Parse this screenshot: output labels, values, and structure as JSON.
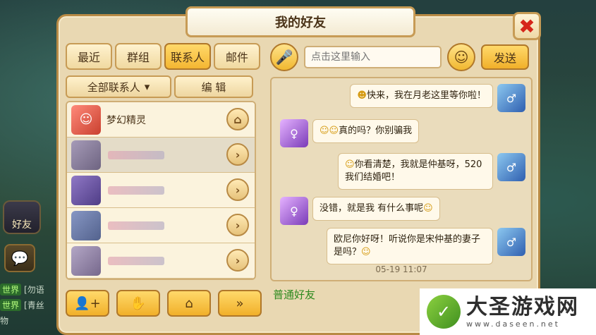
{
  "window": {
    "title": "我的好友",
    "close_icon": "✖"
  },
  "tabs": [
    {
      "label": "最近",
      "active": false
    },
    {
      "label": "群组",
      "active": false
    },
    {
      "label": "联系人",
      "active": true
    },
    {
      "label": "邮件",
      "active": false
    }
  ],
  "filter": {
    "all_contacts": "全部联系人",
    "edit": "编 辑"
  },
  "contacts": [
    {
      "name": "梦幻精灵",
      "action_icon": "home-icon"
    },
    {
      "name": "",
      "action_icon": "chevron-right-icon"
    },
    {
      "name": "",
      "action_icon": "chevron-right-icon"
    },
    {
      "name": "",
      "action_icon": "chevron-right-icon"
    },
    {
      "name": "",
      "action_icon": "chevron-right-icon"
    }
  ],
  "bottom_buttons": [
    "add-friend-icon",
    "hand-icon",
    "home-icon",
    "double-chevron-right-icon"
  ],
  "chat": {
    "placeholder": "点击这里输入",
    "send_label": "发送",
    "messages": [
      {
        "side": "right",
        "text": "快来，我在月老这里等你啦！"
      },
      {
        "side": "left",
        "text": "真的吗？你别骗我"
      },
      {
        "side": "right",
        "text": "你看清楚，我就是仲基呀，520 我们结婚吧！"
      },
      {
        "side": "left",
        "text": "没错，就是我 有什么事呢"
      },
      {
        "side": "right",
        "text": "欧尼你好呀！听说你是宋仲基的妻子是吗？"
      }
    ],
    "timestamp": "05-19 11:07",
    "group_label": "普通好友"
  },
  "hud": {
    "friends_label": "好友",
    "world_lines": [
      {
        "tag": "世界",
        "msg": "[勿语"
      },
      {
        "tag": "世界",
        "msg": "[青丝"
      }
    ],
    "bottom_text": "物"
  },
  "watermark": {
    "title": "大圣游戏网",
    "url": "www.daseen.net"
  },
  "colors": {
    "accent": "#f4b632",
    "frame": "#b88a45",
    "group_green": "#2e8a1f"
  }
}
